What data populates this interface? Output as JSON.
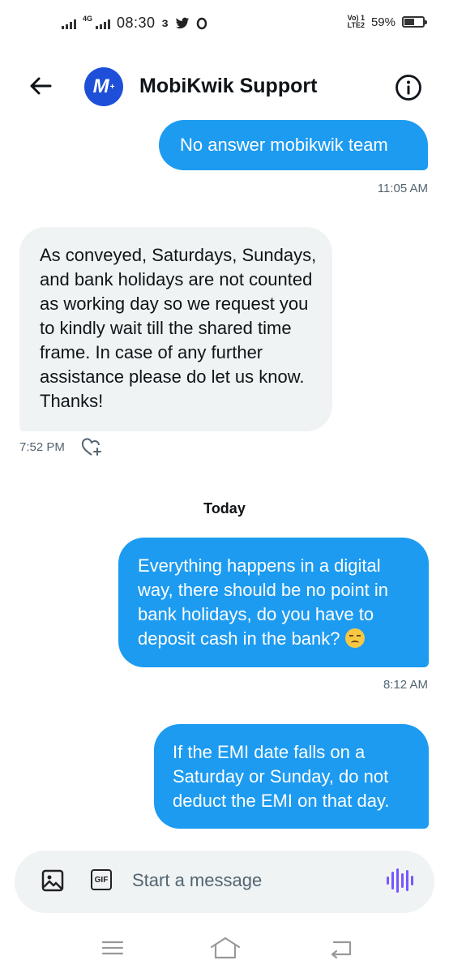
{
  "status_bar": {
    "network": "4G",
    "time": "08:30",
    "app_indicators": "ɜ",
    "carrier": "Vo)) 1\nLTE2",
    "battery_percent": "59%",
    "battery_level": 0.59
  },
  "header": {
    "title": "MobiKwik Support",
    "avatar_letter": "M",
    "avatar_color": "#1e4fd8"
  },
  "messages": [
    {
      "direction": "out",
      "text": "No answer mobikwik team",
      "time": "11:05 AM"
    },
    {
      "direction": "in",
      "text": "As conveyed, Saturdays, Sundays, and bank holidays are not counted as working day so we request you to kindly wait till the shared time frame. In case of any further assistance please do let us know. Thanks!",
      "time": "7:52 PM"
    },
    {
      "direction": "out",
      "text": "Everything happens in a digital way, there should be no point in bank holidays, do you have to deposit cash in the bank?",
      "emoji": "unamused-face",
      "time": "8:12 AM"
    },
    {
      "direction": "out",
      "text": "If the EMI date falls on a Saturday or Sunday, do not deduct the EMI on that day.",
      "time": ""
    }
  ],
  "day_separator": "Today",
  "composer": {
    "placeholder": "Start a message",
    "gif_label": "GIF"
  },
  "colors": {
    "outgoing_bubble": "#1d9bf0",
    "incoming_bubble": "#eff3f4",
    "voice_accent": "#7856ff"
  }
}
